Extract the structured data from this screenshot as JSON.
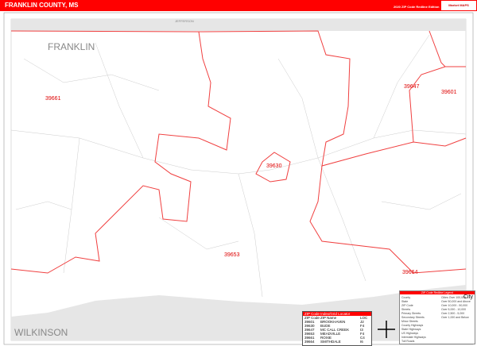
{
  "header": {
    "title": "FRANKLIN COUNTY, MS",
    "edition": "2020 ZIP Code Redline Edition",
    "logo": "Market MAPS"
  },
  "map": {
    "counties": [
      "FRANKLIN",
      "WILKINSON",
      "JEFFERSON"
    ],
    "zip_labels": [
      "39661",
      "39630",
      "39647",
      "39601",
      "39653",
      "39664"
    ],
    "colors": {
      "zip_boundary": "#f04040",
      "outside": "#e6e6e6",
      "header": "#ff0000"
    }
  },
  "index": {
    "title": "ZIP Code Index/Grid Locator",
    "headers": [
      "ZIP Code",
      "ZIP Name",
      "LOC"
    ],
    "rows": [
      [
        "39601",
        "BROOKHAVEN",
        "J2"
      ],
      [
        "39630",
        "BUDE",
        "F4"
      ],
      [
        "39647",
        "MC CALL CREEK",
        "I3"
      ],
      [
        "39653",
        "MEADVILLE",
        "F4"
      ],
      [
        "39661",
        "ROXIE",
        "C4"
      ],
      [
        "39664",
        "SMITHDALE",
        "I6"
      ]
    ]
  },
  "legend": {
    "title": "ZIP Code Redline Legend",
    "items": [
      "County",
      "State",
      "ZIP Code",
      "Streets",
      "Primary Streets",
      "Secondary Streets",
      "Minor Streets",
      "County Highways",
      "State Highways",
      "US Highways",
      "Interstate Highways",
      "Toll Roads"
    ],
    "cities": [
      "Cities Over 100,000",
      "Over 50,000 and Above",
      "Over 10,000 - 50,000",
      "Over 5,000 - 10,000",
      "Over 2,500 - 5,000",
      "Over 1,000 and Below"
    ],
    "city_word": "City"
  }
}
